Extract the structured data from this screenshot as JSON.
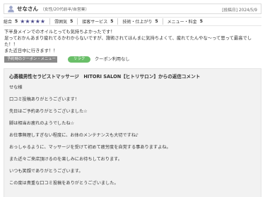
{
  "header": {
    "username": "せなさん",
    "user_meta": "（女性/20代前半/自営業）",
    "post_date": "[投稿日] 2024/5/9"
  },
  "ratings": [
    {
      "label": "総合",
      "value": "5",
      "stars": "★★★★★"
    },
    {
      "label": "雰囲気",
      "value": "5"
    },
    {
      "label": "接客サービス",
      "value": "5"
    },
    {
      "label": "技術・仕上がり",
      "value": "5"
    },
    {
      "label": "メニュー・料金",
      "value": "5"
    }
  ],
  "review": {
    "lines": [
      "下半身メインでのオイルとっても気持ちよかったです！",
      "足っておかんあまり疲れてるかわからないですが、施術されてほんまに気持ちよくて、疲れてたんやな〜って思って最高でした！！",
      "また近日中に行きます！！"
    ]
  },
  "tags": {
    "coupon_label": "予約時のクーポン・メニュー",
    "relax_label": "リラク",
    "coupon_value": "クーポン利用なし"
  },
  "reply": {
    "title": "心斎橋男性セラピストマッサージ　HITORI SALON【ヒトリサロン】からの返信コメント",
    "lines": [
      "せな様",
      "口コミ投稿ありがとうございます！",
      "先日はご予約ありがとうございました☆",
      "脚は相当お疲れのようでしたね☆",
      "お仕事無理しすぎない程度に、お体のメンテナンスも大切ですね♪",
      "おっしゃるように、マッサージを受けて初めて疲労度を自覚する事ありますよね。",
      "また近々ご来店頂けるのを楽しみにお待ちしております。",
      "いつも笑顔でありがとうございます。",
      "この度は貴重な口コミ投稿をありがとうございました。"
    ]
  },
  "colors": {
    "star": "#4a4a8c",
    "relax_tag": "#6abf69",
    "coupon_tag": "#8a8a8a",
    "reply_bg": "#f2f2f2",
    "avatar_icon": "#9da6c9"
  }
}
